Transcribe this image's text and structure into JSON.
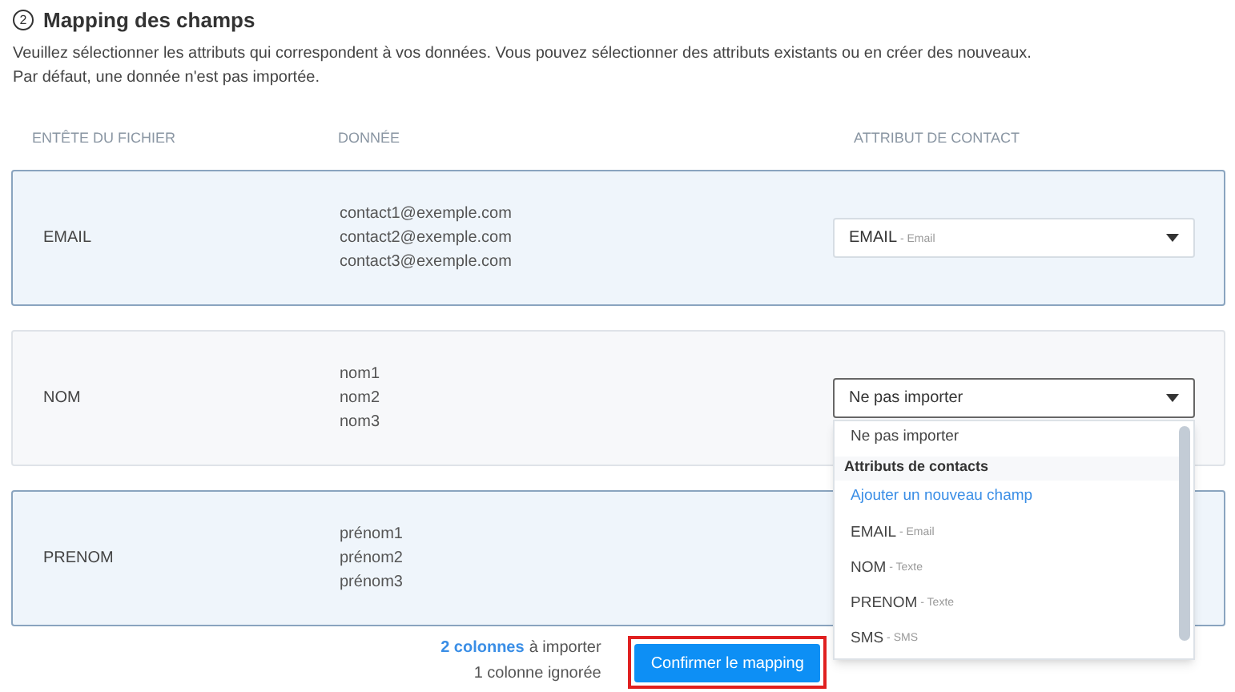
{
  "step": {
    "number": "2",
    "title": "Mapping des champs"
  },
  "intro": [
    "Veuillez sélectionner les attributs qui correspondent à vos données. Vous pouvez sélectionner des attributs existants ou en créer des nouveaux.",
    "Par défaut, une donnée n'est pas importée."
  ],
  "table": {
    "columns": [
      "ENTÊTE DU FICHIER",
      "DONNÉE",
      "ATTRIBUT DE CONTACT"
    ],
    "rows": [
      {
        "header": "EMAIL",
        "data": [
          "contact1@exemple.com",
          "contact2@exemple.com",
          "contact3@exemple.com"
        ],
        "mapped": true,
        "select": {
          "name": "EMAIL",
          "type": "- Email",
          "expanded": false
        }
      },
      {
        "header": "NOM",
        "data": [
          "nom1",
          "nom2",
          "nom3"
        ],
        "mapped": false,
        "select": {
          "name": "Ne pas importer",
          "expanded": true
        }
      },
      {
        "header": "PRENOM",
        "data": [
          "prénom1",
          "prénom2",
          "prénom3"
        ],
        "mapped": true
      }
    ]
  },
  "dropdown": [
    {
      "kind": "option",
      "name": "Ne pas importer"
    },
    {
      "kind": "group",
      "name": "Attributs de contacts"
    },
    {
      "kind": "action",
      "name": "Ajouter un nouveau champ"
    },
    {
      "kind": "option",
      "name": "EMAIL",
      "type": "- Email"
    },
    {
      "kind": "option",
      "name": "NOM",
      "type": "- Texte"
    },
    {
      "kind": "option",
      "name": "PRENOM",
      "type": "- Texte"
    },
    {
      "kind": "option",
      "name": "SMS",
      "type": "- SMS"
    }
  ],
  "summary": {
    "count": "2 colonnes",
    "count_suffix": "à importer",
    "ignored": "1 colonne ignorée"
  },
  "confirm_button": {
    "label": "Confirmer le mapping",
    "highlighted": true
  }
}
